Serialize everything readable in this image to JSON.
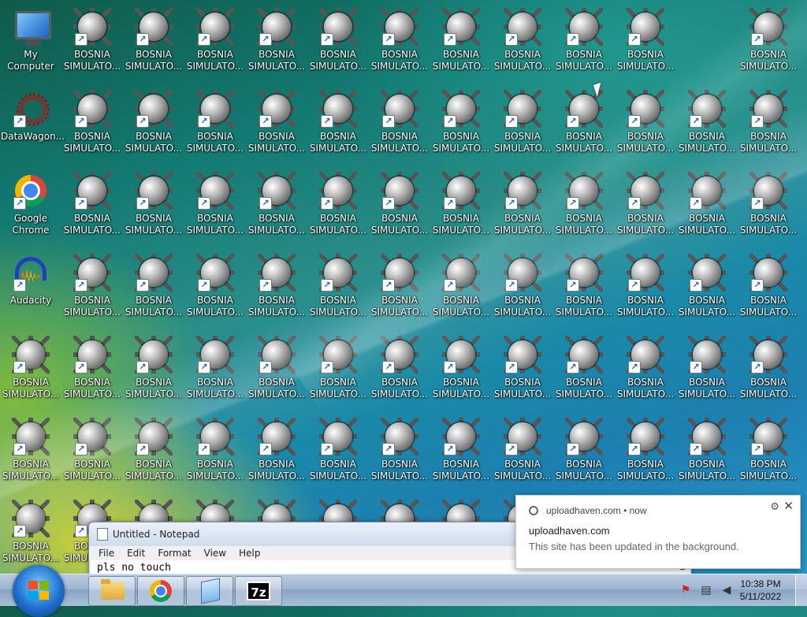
{
  "desktop": {
    "shortcut_label": "BOSNIA\nSIMULATO...",
    "system_icons": [
      {
        "label": "My Computer",
        "icon": "computer-icon"
      },
      {
        "label": "DataWagon...",
        "icon": "datawagon-icon"
      },
      {
        "label": "Google\nChrome",
        "icon": "chrome-icon"
      },
      {
        "label": "Audacity",
        "icon": "audacity-icon"
      }
    ]
  },
  "notepad": {
    "title": "Untitled - Notepad",
    "menu": [
      "File",
      "Edit",
      "Format",
      "View",
      "Help"
    ],
    "content": "pls no touch"
  },
  "notification": {
    "source": "uploadhaven.com",
    "time": "now",
    "title": "uploadhaven.com",
    "message": "This site has been updated in the background."
  },
  "taskbar": {
    "pinned": [
      "explorer-icon",
      "chrome-icon",
      "notepad-icon",
      "7zip-icon"
    ],
    "sevenzip_label": "7z",
    "clock_time": "10:38 PM",
    "clock_date": "5/11/2022"
  },
  "colors": {
    "taskbar": "#9fb6d2",
    "start_orb": "#1f6fcf"
  }
}
